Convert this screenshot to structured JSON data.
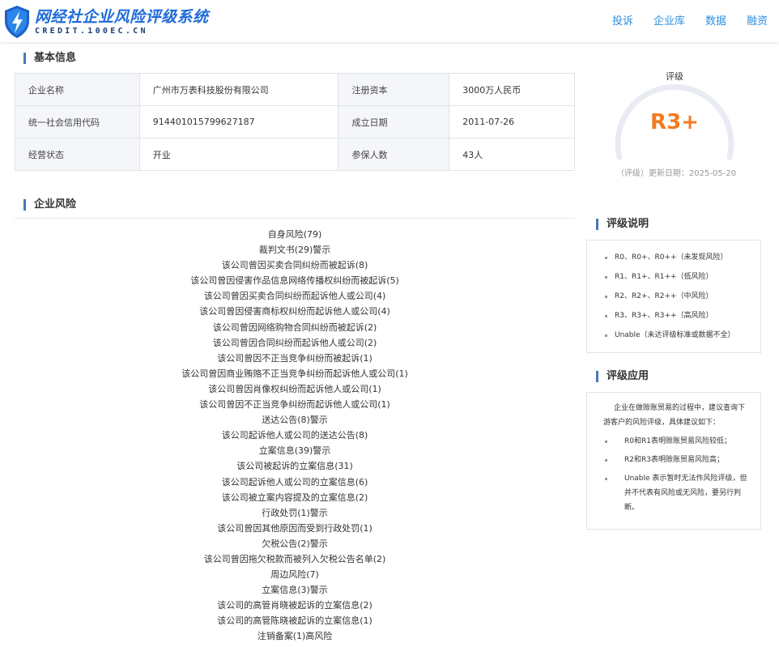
{
  "header": {
    "logo_title": "网经社企业风险评级系统",
    "logo_subtitle": "CREDIT.100EC.CN",
    "nav": [
      "投诉",
      "企业库",
      "数据",
      "融资"
    ]
  },
  "basic_info": {
    "title": "基本信息",
    "rows": [
      [
        {
          "label": "企业名称",
          "value": "广州市万表科技股份有限公司"
        },
        {
          "label": "注册资本",
          "value": "3000万人民币"
        }
      ],
      [
        {
          "label": "统一社会信用代码",
          "value": "914401015799627187"
        },
        {
          "label": "成立日期",
          "value": "2011-07-26"
        }
      ],
      [
        {
          "label": "经营状态",
          "value": "开业"
        },
        {
          "label": "参保人数",
          "value": "43人"
        }
      ]
    ]
  },
  "rating": {
    "label": "评级",
    "value": "R3+",
    "update_text": "（评级）更新日期：2025-05-20",
    "colors": {
      "value": "#f37a23",
      "arc": "#e8ecf2"
    }
  },
  "risk": {
    "title": "企业风险",
    "items": [
      "自身风险(79)",
      "裁判文书(29)警示",
      "该公司曾因买卖合同纠纷而被起诉(8)",
      "该公司曾因侵害作品信息网络传播权纠纷而被起诉(5)",
      "该公司曾因买卖合同纠纷而起诉他人或公司(4)",
      "该公司曾因侵害商标权纠纷而起诉他人或公司(4)",
      "该公司曾因网络购物合同纠纷而被起诉(2)",
      "该公司曾因合同纠纷而起诉他人或公司(2)",
      "该公司曾因不正当竞争纠纷而被起诉(1)",
      "该公司曾因商业贿赂不正当竞争纠纷而起诉他人或公司(1)",
      "该公司曾因肖像权纠纷而起诉他人或公司(1)",
      "该公司曾因不正当竞争纠纷而起诉他人或公司(1)",
      "送达公告(8)警示",
      "该公司起诉他人或公司的送达公告(8)",
      "立案信息(39)警示",
      "该公司被起诉的立案信息(31)",
      "该公司起诉他人或公司的立案信息(6)",
      "该公司被立案内容提及的立案信息(2)",
      "行政处罚(1)警示",
      "该公司曾因其他原因而受到行政处罚(1)",
      "欠税公告(2)警示",
      "该公司曾因拖欠税款而被列入欠税公告名单(2)",
      "周边风险(7)",
      "立案信息(3)警示",
      "该公司的高管肖晓被起诉的立案信息(2)",
      "该公司的高管陈晓被起诉的立案信息(1)",
      "注销备案(1)高风险"
    ]
  },
  "rating_explain": {
    "title": "评级说明",
    "items": [
      "R0、R0+、R0++（未发现风险）",
      "R1、R1+、R1++（低风险）",
      "R2、R2+、R2++（中风险）",
      "R3、R3+、R3++（高风险）",
      "Unable（未达评级标准或数据不全）"
    ]
  },
  "rating_apply": {
    "title": "评级应用",
    "intro": "企业在做赊账贸易的过程中，建议查询下游客户的风险评级，具体建议如下：",
    "items": [
      "R0和R1表明赊账贸易风险较低；",
      "R2和R3表明赊账贸易风险高；",
      "Unable 表示暂时无法作风险评级，但并不代表有风险或无风险，要另行判断。"
    ]
  }
}
